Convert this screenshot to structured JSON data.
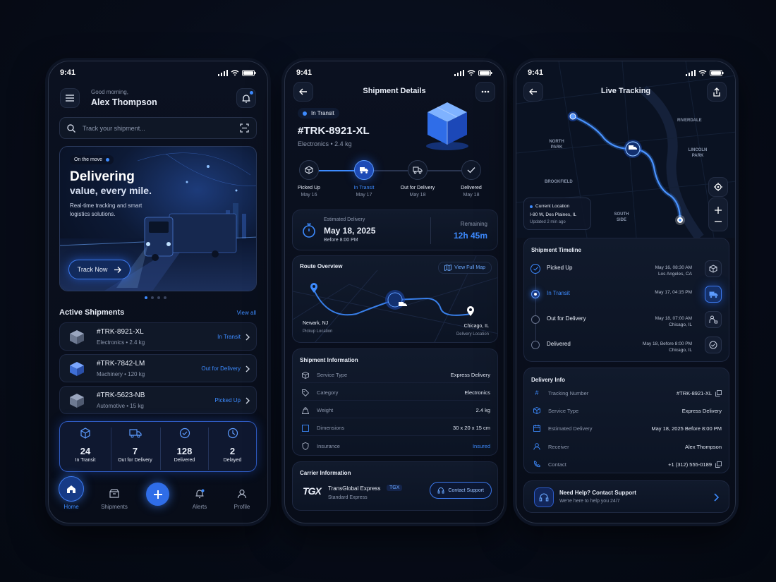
{
  "status_time": "9:41",
  "home": {
    "greeting": "Good morning,",
    "user_name": "Alex Thompson",
    "search_placeholder": "Track your shipment...",
    "hero": {
      "badge": "On the move",
      "title_1": "Delivering",
      "title_2": "value, every mile.",
      "subtitle": "Real-time tracking and smart logistics solutions.",
      "cta": "Track Now"
    },
    "active_title": "Active Shipments",
    "view_all": "View all",
    "shipments": [
      {
        "id": "#TRK-8921-XL",
        "category": "Electronics",
        "weight": "2.4 kg",
        "status": "In Transit"
      },
      {
        "id": "#TRK-7842-LM",
        "category": "Machinery",
        "weight": "120 kg",
        "status": "Out for Delivery"
      },
      {
        "id": "#TRK-5623-NB",
        "category": "Automotive",
        "weight": "15 kg",
        "status": "Picked Up"
      }
    ],
    "stats": [
      {
        "value": "24",
        "label": "In Transit",
        "icon": "box-icon"
      },
      {
        "value": "7",
        "label": "Out for Delivery",
        "icon": "truck-icon"
      },
      {
        "value": "128",
        "label": "Delivered",
        "icon": "check-circle-icon"
      },
      {
        "value": "2",
        "label": "Delayed",
        "icon": "clock-icon"
      }
    ],
    "nav": [
      "Home",
      "Shipments",
      "Alerts",
      "Profile"
    ]
  },
  "details": {
    "title": "Shipment Details",
    "status_badge": "In Transit",
    "tracking_id": "#TRK-8921-XL",
    "category": "Electronics",
    "weight": "2.4 kg",
    "steps": [
      {
        "label": "Picked Up",
        "date": "May 16"
      },
      {
        "label": "In Transit",
        "date": "May 17"
      },
      {
        "label": "Out for Delivery",
        "date": "May 18"
      },
      {
        "label": "Delivered",
        "date": "May 18"
      }
    ],
    "eta_label": "Estimated Delivery",
    "eta_date": "May 18, 2025",
    "eta_time": "Before 8:00 PM",
    "remaining_label": "Remaining",
    "remaining_value": "12h 45m",
    "route_title": "Route Overview",
    "view_full_map": "View Full Map",
    "origin_city": "Newark, NJ",
    "origin_label": "Pickup Location",
    "dest_city": "Chicago, IL",
    "dest_label": "Delivery Location",
    "info_title": "Shipment Information",
    "info": [
      {
        "label": "Service Type",
        "value": "Express Delivery"
      },
      {
        "label": "Category",
        "value": "Electronics"
      },
      {
        "label": "Weight",
        "value": "2.4 kg"
      },
      {
        "label": "Dimensions",
        "value": "30 x 20 x 15 cm"
      },
      {
        "label": "Insurance",
        "value": "Insured"
      }
    ],
    "carrier_title": "Carrier Information",
    "carrier_logo": "TGX",
    "carrier_name": "TransGlobal Express",
    "carrier_tag": "TGX",
    "carrier_service": "Standard Express",
    "contact_support": "Contact Support"
  },
  "tracking": {
    "title": "Live Tracking",
    "map_labels": [
      "RIVERDALE",
      "NORTH PARK",
      "LINCOLN PARK",
      "BROOKFIELD",
      "SOUTH SIDE"
    ],
    "current_location_label": "Current Location",
    "current_location": "I-80 W, Des Plaines, IL",
    "updated": "Updated 2 min ago",
    "timeline_title": "Shipment Timeline",
    "timeline": [
      {
        "label": "Picked Up",
        "date": "May 16, 08:30 AM",
        "place": "Los Angeles, CA"
      },
      {
        "label": "In Transit",
        "date": "May 17, 04:15 PM",
        "place": ""
      },
      {
        "label": "Out for Delivery",
        "date": "May 18, 07:00 AM",
        "place": "Chicago, IL"
      },
      {
        "label": "Delivered",
        "date": "May 18, Before 8:00 PM",
        "place": "Chicago, IL"
      }
    ],
    "delivery_title": "Delivery Info",
    "delivery": [
      {
        "label": "Tracking Number",
        "value": "#TRK-8921-XL"
      },
      {
        "label": "Service Type",
        "value": "Express Delivery"
      },
      {
        "label": "Estimated Delivery",
        "value": "May 18, 2025 Before 8:00 PM"
      },
      {
        "label": "Receiver",
        "value": "Alex Thompson"
      },
      {
        "label": "Contact",
        "value": "+1 (312) 555-0189"
      }
    ],
    "help_title": "Need Help? Contact Support",
    "help_sub": "We're here to help you 24/7"
  }
}
